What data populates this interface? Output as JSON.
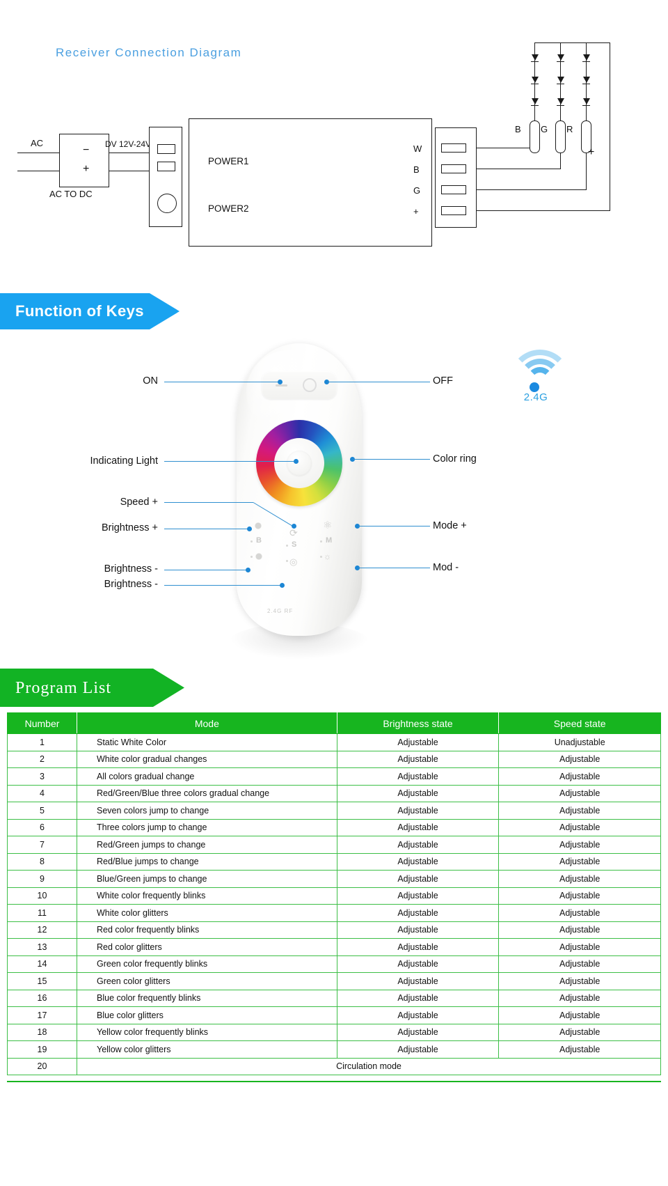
{
  "diagram": {
    "title": "Receiver  Connection  Diagram",
    "ac_label": "AC",
    "converter_label": "AC  TO  DC",
    "minus_sign": "−",
    "plus_sign": "+",
    "dc_label": "DV  12V-24V",
    "power1": "POWER1",
    "power2": "POWER2",
    "out_w": "W",
    "out_b": "B",
    "out_g": "G",
    "out_plus": "+",
    "strip_b": "B",
    "strip_g": "G",
    "strip_r": "R",
    "strip_plus": "+"
  },
  "keys_section": {
    "banner": "Function of Keys",
    "callouts_left": [
      {
        "label": "ON"
      },
      {
        "label": "Indicating  Light"
      },
      {
        "label": "Speed  +"
      },
      {
        "label": "Brightness  +"
      },
      {
        "label": "Brightness  -"
      },
      {
        "label": "Brightness  -"
      }
    ],
    "callouts_right": [
      {
        "label": "OFF"
      },
      {
        "label": "Color  ring"
      },
      {
        "label": "Mode  +"
      },
      {
        "label": "Mod  -"
      }
    ],
    "wifi_label": "2.4G",
    "remote_glyphs": {
      "brightness_letter": "B",
      "speed_letter": "S",
      "mode_letter": "M",
      "footer": "2.4G RF"
    }
  },
  "program_section": {
    "banner": "Program List",
    "columns": [
      "Number",
      "Mode",
      "Brightness state",
      "Speed state"
    ],
    "rows": [
      {
        "number": "1",
        "mode": "Static White Color",
        "brightness": "Adjustable",
        "speed": "Unadjustable"
      },
      {
        "number": "2",
        "mode": "White color  gradual  changes",
        "brightness": "Adjustable",
        "speed": "Adjustable"
      },
      {
        "number": "3",
        "mode": "All  colors  gradual  change",
        "brightness": "Adjustable",
        "speed": "Adjustable"
      },
      {
        "number": "4",
        "mode": "Red/Green/Blue  three  colors  gradual  change",
        "brightness": "Adjustable",
        "speed": "Adjustable"
      },
      {
        "number": "5",
        "mode": "Seven  colors  jump  to  change",
        "brightness": "Adjustable",
        "speed": "Adjustable"
      },
      {
        "number": "6",
        "mode": "Three  colors  jump  to  change",
        "brightness": "Adjustable",
        "speed": "Adjustable"
      },
      {
        "number": "7",
        "mode": "Red/Green  jumps  to  change",
        "brightness": "Adjustable",
        "speed": "Adjustable"
      },
      {
        "number": "8",
        "mode": "Red/Blue  jumps  to  change",
        "brightness": "Adjustable",
        "speed": "Adjustable"
      },
      {
        "number": "9",
        "mode": "Blue/Green  jumps  to  change",
        "brightness": "Adjustable",
        "speed": "Adjustable"
      },
      {
        "number": "10",
        "mode": "White  color  frequently  blinks",
        "brightness": "Adjustable",
        "speed": "Adjustable"
      },
      {
        "number": "11",
        "mode": "White  color  glitters",
        "brightness": "Adjustable",
        "speed": "Adjustable"
      },
      {
        "number": "12",
        "mode": "Red  color  frequently  blinks",
        "brightness": "Adjustable",
        "speed": "Adjustable"
      },
      {
        "number": "13",
        "mode": "Red  color  glitters",
        "brightness": "Adjustable",
        "speed": "Adjustable"
      },
      {
        "number": "14",
        "mode": "Green  color  frequently  blinks",
        "brightness": "Adjustable",
        "speed": "Adjustable"
      },
      {
        "number": "15",
        "mode": "Green  color  glitters",
        "brightness": "Adjustable",
        "speed": "Adjustable"
      },
      {
        "number": "16",
        "mode": "Blue  color  frequently  blinks",
        "brightness": "Adjustable",
        "speed": "Adjustable"
      },
      {
        "number": "17",
        "mode": "Blue  color  glitters",
        "brightness": "Adjustable",
        "speed": "Adjustable"
      },
      {
        "number": "18",
        "mode": "Yellow  color  frequently  blinks",
        "brightness": "Adjustable",
        "speed": "Adjustable"
      },
      {
        "number": "19",
        "mode": "Yellow  color  glitters",
        "brightness": "Adjustable",
        "speed": "Adjustable"
      }
    ],
    "last_row": {
      "number": "20",
      "mode": "Circulation mode"
    }
  },
  "colors": {
    "blue_banner": "#19a3f0",
    "green_banner": "#12b324",
    "table_header": "#17b51f",
    "table_border": "#3cbf46",
    "callout_line": "#2f8fd0",
    "title_blue": "#4a9fe0",
    "wifi_blue": "#2a9fe0"
  }
}
